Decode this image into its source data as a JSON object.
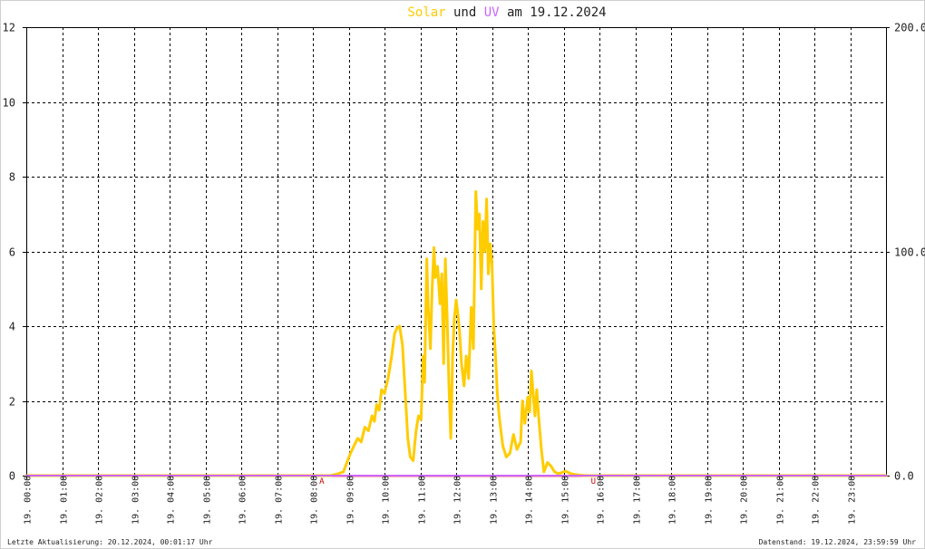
{
  "chart_data": {
    "type": "line",
    "title": {
      "part1": "Solar",
      "part2": " und ",
      "part3": "UV",
      "part4": " am 19.12.2024"
    },
    "colors": {
      "solar": "#ffcc00",
      "uv": "#cc66ff",
      "title_solar": "#ffcc00",
      "title_uv": "#cc66ff",
      "title_text": "#222222",
      "baseline": "#ff6666",
      "grid": "#000000",
      "marker": "#cc0000"
    },
    "y_left": {
      "ylim": [
        0,
        12
      ],
      "ticks": [
        "0",
        "2",
        "4",
        "6",
        "8",
        "10",
        "12"
      ]
    },
    "y_right": {
      "ylim": [
        0,
        200
      ],
      "ticks": [
        "0.0",
        "100.0",
        "200.0"
      ]
    },
    "x_axis": {
      "xlim": [
        0,
        24
      ],
      "ticks": [
        "19. 00:00",
        "19. 01:00",
        "19. 02:00",
        "19. 03:00",
        "19. 04:00",
        "19. 05:00",
        "19. 06:00",
        "19. 07:00",
        "19. 08:00",
        "19. 09:00",
        "19. 10:00",
        "19. 11:00",
        "19. 12:00",
        "19. 13:00",
        "19. 14:00",
        "19. 15:00",
        "19. 16:00",
        "19. 17:00",
        "19. 18:00",
        "19. 19:00",
        "19. 20:00",
        "19. 21:00",
        "19. 22:00",
        "19. 23:00"
      ]
    },
    "grid": true,
    "markers": [
      {
        "label": "A",
        "x": 8.25
      },
      {
        "label": "U",
        "x": 15.83
      }
    ],
    "series": [
      {
        "key": "solar",
        "x": [
          0,
          8.5,
          8.7,
          8.85,
          8.95,
          9.05,
          9.15,
          9.25,
          9.35,
          9.45,
          9.55,
          9.65,
          9.72,
          9.78,
          9.85,
          9.92,
          10.0,
          10.1,
          10.2,
          10.28,
          10.35,
          10.42,
          10.5,
          10.58,
          10.65,
          10.72,
          10.8,
          10.88,
          10.95,
          11.02,
          11.08,
          11.12,
          11.18,
          11.22,
          11.28,
          11.33,
          11.38,
          11.42,
          11.48,
          11.55,
          11.6,
          11.65,
          11.7,
          11.75,
          11.8,
          11.85,
          11.9,
          11.95,
          12.0,
          12.05,
          12.1,
          12.15,
          12.22,
          12.28,
          12.35,
          12.42,
          12.48,
          12.55,
          12.6,
          12.65,
          12.7,
          12.75,
          12.8,
          12.85,
          12.9,
          12.95,
          13.0,
          13.05,
          13.1,
          13.15,
          13.2,
          13.3,
          13.4,
          13.5,
          13.6,
          13.7,
          13.8,
          13.85,
          13.92,
          14.0,
          14.05,
          14.1,
          14.15,
          14.2,
          14.25,
          14.3,
          14.38,
          14.45,
          14.55,
          14.65,
          14.75,
          14.85,
          14.95,
          15.05,
          15.2,
          15.4,
          15.6,
          15.8,
          16.0,
          24
        ],
        "y": [
          0,
          0,
          0.05,
          0.1,
          0.35,
          0.6,
          0.8,
          1.0,
          0.9,
          1.3,
          1.2,
          1.6,
          1.45,
          1.9,
          1.75,
          2.3,
          2.2,
          2.6,
          3.2,
          3.8,
          3.95,
          4.0,
          3.5,
          2.2,
          1.0,
          0.5,
          0.4,
          1.2,
          1.6,
          1.5,
          3.2,
          2.5,
          5.8,
          4.5,
          3.4,
          5.0,
          6.1,
          5.3,
          5.6,
          4.6,
          5.4,
          3.0,
          5.8,
          4.2,
          2.4,
          1.0,
          3.2,
          4.2,
          4.7,
          4.3,
          3.8,
          3.0,
          2.4,
          3.2,
          2.6,
          4.5,
          3.4,
          7.6,
          6.6,
          7.0,
          5.0,
          6.8,
          6.0,
          7.4,
          5.4,
          6.2,
          5.7,
          4.0,
          3.2,
          2.2,
          1.6,
          0.8,
          0.5,
          0.6,
          1.1,
          0.7,
          0.9,
          2.0,
          1.4,
          2.1,
          1.7,
          2.8,
          2.2,
          1.6,
          2.3,
          1.6,
          0.7,
          0.1,
          0.35,
          0.25,
          0.1,
          0.05,
          0.08,
          0.12,
          0.05,
          0.02,
          0,
          0,
          0,
          0
        ]
      },
      {
        "key": "uv",
        "x": [
          0,
          8.5,
          16.0,
          24
        ],
        "y": [
          0,
          0,
          0,
          0
        ]
      }
    ]
  },
  "footer": {
    "left": "Letzte Aktualisierung: 20.12.2024, 00:01:17 Uhr",
    "right": "Datenstand: 19.12.2024, 23:59:59 Uhr"
  }
}
